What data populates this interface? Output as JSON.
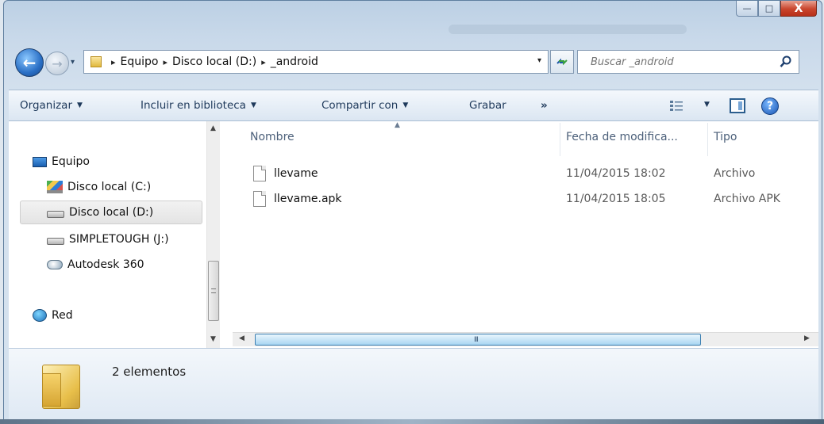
{
  "window": {
    "caption_buttons": {
      "minimize": "—",
      "maximize": "□",
      "close": "X"
    }
  },
  "nav": {
    "back": "←",
    "forward": "→",
    "recent": "▾"
  },
  "address": {
    "crumbs": [
      "Equipo",
      "Disco local (D:)",
      "_android"
    ],
    "separator": "▸",
    "dropdown": "▾"
  },
  "search": {
    "placeholder": "Buscar _android"
  },
  "toolbar": {
    "organize": "Organizar",
    "include_library": "Incluir en biblioteca",
    "share_with": "Compartir con",
    "burn": "Grabar",
    "more": "»",
    "help": "?"
  },
  "nav_pane": {
    "items": [
      {
        "label": "Equipo",
        "icon": "computer-icon"
      },
      {
        "label": "Disco local (C:)",
        "icon": "system-drive-icon"
      },
      {
        "label": "Disco local (D:)",
        "icon": "drive-icon",
        "selected": true
      },
      {
        "label": "SIMPLETOUGH (J:)",
        "icon": "drive-icon"
      },
      {
        "label": "Autodesk 360",
        "icon": "cloud-icon"
      },
      {
        "label": "Red",
        "icon": "network-icon"
      }
    ]
  },
  "file_list": {
    "columns": [
      "Nombre",
      "Fecha de modifica...",
      "Tipo"
    ],
    "rows": [
      {
        "name": "llevame",
        "date": "11/04/2015 18:02",
        "type": "Archivo"
      },
      {
        "name": "llevame.apk",
        "date": "11/04/2015 18:05",
        "type": "Archivo APK"
      }
    ]
  },
  "scroll": {
    "grip": "III"
  },
  "details": {
    "count": "2 elementos"
  },
  "colors": {
    "accent": "#1e395b",
    "selection_bg": "#e8e8e8",
    "scroll_thumb": "#a8d5f2"
  }
}
